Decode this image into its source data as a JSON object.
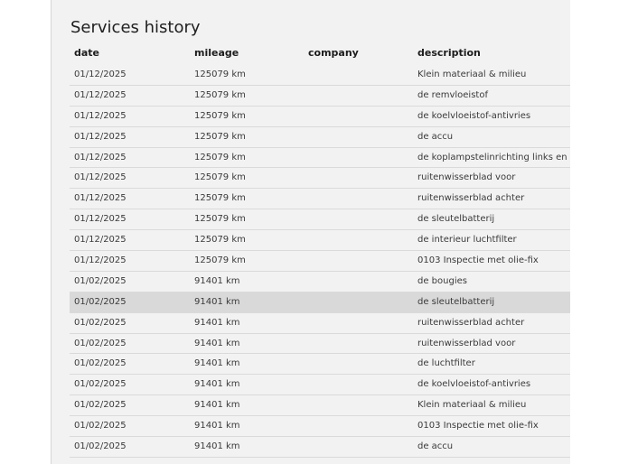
{
  "title": "Services history",
  "columns": {
    "date": "date",
    "mileage": "mileage",
    "company": "company",
    "description": "description"
  },
  "rows": [
    {
      "date": "01/12/2025",
      "mileage": "125079 km",
      "company": "",
      "description": "Klein materiaal & milieu"
    },
    {
      "date": "01/12/2025",
      "mileage": "125079 km",
      "company": "",
      "description": "de remvloeistof"
    },
    {
      "date": "01/12/2025",
      "mileage": "125079 km",
      "company": "",
      "description": "de koelvloeistof-antivries"
    },
    {
      "date": "01/12/2025",
      "mileage": "125079 km",
      "company": "",
      "description": "de accu"
    },
    {
      "date": "01/12/2025",
      "mileage": "125079 km",
      "company": "",
      "description": "de koplampstelinrichting links en rechts"
    },
    {
      "date": "01/12/2025",
      "mileage": "125079 km",
      "company": "",
      "description": "ruitenwisserblad voor"
    },
    {
      "date": "01/12/2025",
      "mileage": "125079 km",
      "company": "",
      "description": "ruitenwisserblad achter"
    },
    {
      "date": "01/12/2025",
      "mileage": "125079 km",
      "company": "",
      "description": "de sleutelbatterij"
    },
    {
      "date": "01/12/2025",
      "mileage": "125079 km",
      "company": "",
      "description": "de interieur luchtfilter"
    },
    {
      "date": "01/12/2025",
      "mileage": "125079 km",
      "company": "",
      "description": "0103 Inspectie met olie-fix"
    },
    {
      "date": "01/02/2025",
      "mileage": "91401 km",
      "company": "",
      "description": "de bougies"
    },
    {
      "date": "01/02/2025",
      "mileage": "91401 km",
      "company": "",
      "description": "de sleutelbatterij",
      "selected": true
    },
    {
      "date": "01/02/2025",
      "mileage": "91401 km",
      "company": "",
      "description": "ruitenwisserblad achter"
    },
    {
      "date": "01/02/2025",
      "mileage": "91401 km",
      "company": "",
      "description": "ruitenwisserblad voor"
    },
    {
      "date": "01/02/2025",
      "mileage": "91401 km",
      "company": "",
      "description": "de luchtfilter"
    },
    {
      "date": "01/02/2025",
      "mileage": "91401 km",
      "company": "",
      "description": "de koelvloeistof-antivries"
    },
    {
      "date": "01/02/2025",
      "mileage": "91401 km",
      "company": "",
      "description": "Klein materiaal & milieu"
    },
    {
      "date": "01/02/2025",
      "mileage": "91401 km",
      "company": "",
      "description": "0103 Inspectie met olie-fix"
    },
    {
      "date": "01/02/2025",
      "mileage": "91401 km",
      "company": "",
      "description": "de accu"
    }
  ]
}
